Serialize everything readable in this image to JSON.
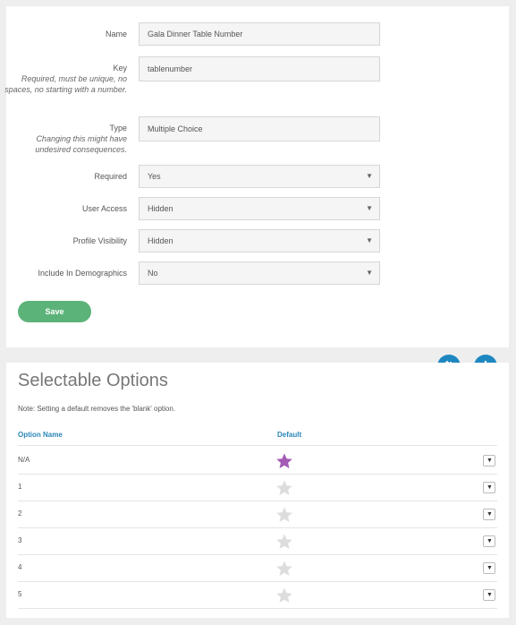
{
  "form": {
    "name": {
      "label": "Name",
      "value": "Gala Dinner Table Number"
    },
    "key": {
      "label": "Key",
      "hint": "Required, must be unique, no spaces, no starting with a number.",
      "value": "tablenumber"
    },
    "type": {
      "label": "Type",
      "hint": "Changing this might have undesired consequences.",
      "value": "Multiple Choice"
    },
    "required": {
      "label": "Required",
      "value": "Yes"
    },
    "user_access": {
      "label": "User Access",
      "value": "Hidden"
    },
    "profile_visibility": {
      "label": "Profile Visibility",
      "value": "Hidden"
    },
    "include_in_demographics": {
      "label": "Include In Demographics",
      "value": "No"
    },
    "save_label": "Save"
  },
  "options_section": {
    "title": "Selectable Options",
    "note": "Note: Setting a default removes the 'blank' option.",
    "columns": {
      "name": "Option Name",
      "default": "Default"
    },
    "rows": [
      {
        "name": "N/A",
        "default": true
      },
      {
        "name": "1",
        "default": false
      },
      {
        "name": "2",
        "default": false
      },
      {
        "name": "3",
        "default": false
      },
      {
        "name": "4",
        "default": false
      },
      {
        "name": "5",
        "default": false
      }
    ]
  },
  "icons": {
    "sort": "sort-icon",
    "add": "plus-icon",
    "star": "star-icon",
    "dropdown": "caret-down-icon"
  },
  "colors": {
    "save": "#5cb379",
    "accent": "#1e87c0",
    "star_active": "#a35bb5",
    "star_inactive": "#dddddd",
    "header_text": "#2a86b7"
  }
}
